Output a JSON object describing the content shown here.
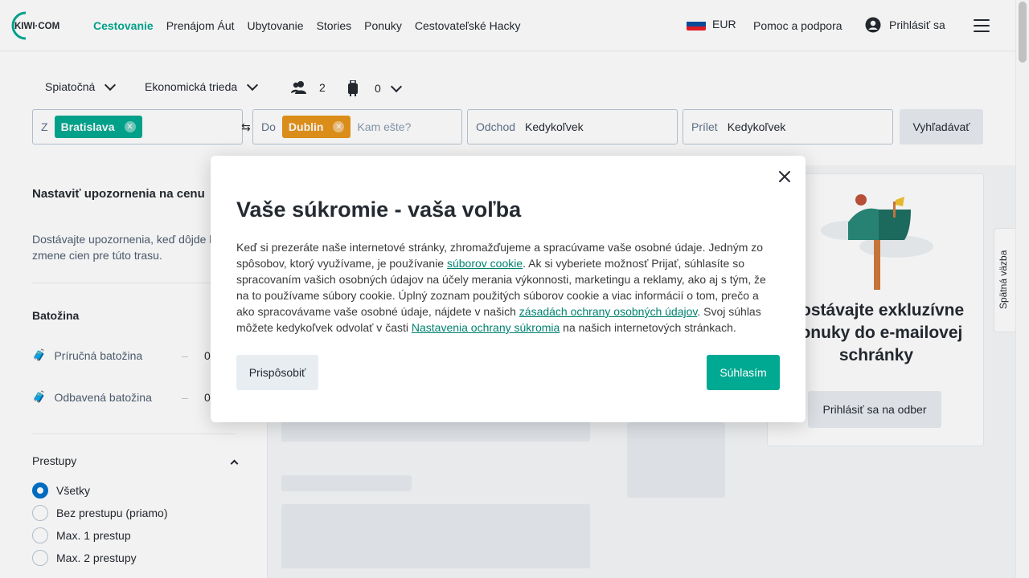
{
  "header": {
    "logo_text": "KIWI·COM",
    "nav": [
      "Cestovanie",
      "Prenájom Áut",
      "Ubytovanie",
      "Stories",
      "Ponuky",
      "Cestovateľské Hacky"
    ],
    "currency": "EUR",
    "help": "Pomoc a podpora",
    "login": "Prihlásiť sa"
  },
  "search": {
    "trip_type": "Spiatočná",
    "cabin_class": "Ekonomická trieda",
    "passengers": "2",
    "bags": "0",
    "from_label": "Z",
    "from_chip": "Bratislava",
    "to_label": "Do",
    "to_chip": "Dublin",
    "to_placeholder": "Kam ešte?",
    "depart_label": "Odchod",
    "depart_value": "Kedykoľvek",
    "return_label": "Prílet",
    "return_value": "Kedykoľvek",
    "search_button": "Vyhľadávať"
  },
  "sidebar": {
    "alert_title": "Nastaviť upozornenia na cenu",
    "alert_desc": "Dostávajte upozornenia, keď dôjde k zmene cien pre túto trasu.",
    "bags_title": "Batožina",
    "cabin_bag": "Príručná batožina",
    "cabin_bag_count": "0",
    "checked_bag": "Odbavená batožina",
    "checked_bag_count": "0",
    "stops_title": "Prestupy",
    "stops_options": [
      "Všetky",
      "Bez prestupu (priamo)",
      "Max. 1 prestup",
      "Max. 2 prestupy"
    ]
  },
  "promo": {
    "title": "Dostávajte exkluzívne ponuky do e-mailovej schránky",
    "button": "Prihlásiť sa na odber"
  },
  "feedback": "Spätná väzba",
  "modal": {
    "title": "Vaše súkromie - vaša voľba",
    "text_1": "Keď si prezeráte naše internetové stránky, zhromažďujeme a spracúvame vaše osobné údaje. Jedným zo spôsobov, ktorý využívame, je používanie ",
    "link_1": "súborov cookie",
    "text_2": ". Ak si vyberiete možnosť Prijať, súhlasíte so spracovaním vašich osobných údajov na účely merania výkonnosti, marketingu a reklamy, ako aj s tým, že na to používame súbory cookie. Úplný zoznam použitých súborov cookie a viac informácií o tom, prečo a ako spracovávame vaše osobné údaje, nájdete v našich ",
    "link_2": "zásadách ochrany osobných údajov",
    "text_3": ". Svoj súhlas môžete kedykoľvek odvolať v časti ",
    "link_3": "Nastavenia ochrany súkromia",
    "text_4": " na našich internetových stránkach.",
    "customize": "Prispôsobiť",
    "accept": "Súhlasím"
  },
  "colors": {
    "brand": "#00a991",
    "from_chip": "#00a991",
    "to_chip": "#e7951b",
    "radio_selected": "#0172cb"
  }
}
